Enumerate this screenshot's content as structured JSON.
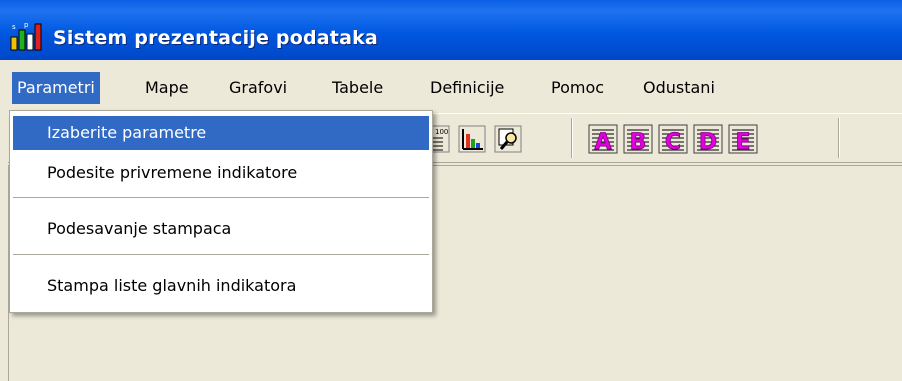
{
  "window": {
    "title": "Sistem prezentacije podataka",
    "title_bar_color": "#0054E3"
  },
  "menubar": {
    "items": [
      {
        "label": "Parametri",
        "active": true
      },
      {
        "label": "Mape"
      },
      {
        "label": "Grafovi"
      },
      {
        "label": "Tabele"
      },
      {
        "label": "Definicije"
      },
      {
        "label": "Pomoc"
      },
      {
        "label": "Odustani"
      }
    ]
  },
  "parametri_menu": {
    "items": [
      {
        "label": "Izaberite parametre",
        "highlighted": true
      },
      {
        "label": "Podesite privremene indikatore"
      },
      {
        "label": "Podesavanje stampaca"
      },
      {
        "label": "Stampa liste glavnih indikatora"
      }
    ]
  },
  "toolbar": {
    "buttons": [
      {
        "icon": "numbered-list-icon"
      },
      {
        "icon": "bar-chart-icon"
      },
      {
        "icon": "magnifier-icon"
      },
      {
        "icon": "letter-a-icon",
        "letter": "A"
      },
      {
        "icon": "letter-b-icon",
        "letter": "B"
      },
      {
        "icon": "letter-c-icon",
        "letter": "C"
      },
      {
        "icon": "letter-d-icon",
        "letter": "D"
      },
      {
        "icon": "letter-e-icon",
        "letter": "E"
      }
    ]
  },
  "colors": {
    "menu_highlight": "#316AC5",
    "letter_icon_magenta": "#E000E0",
    "face": "#ECE9D8"
  }
}
